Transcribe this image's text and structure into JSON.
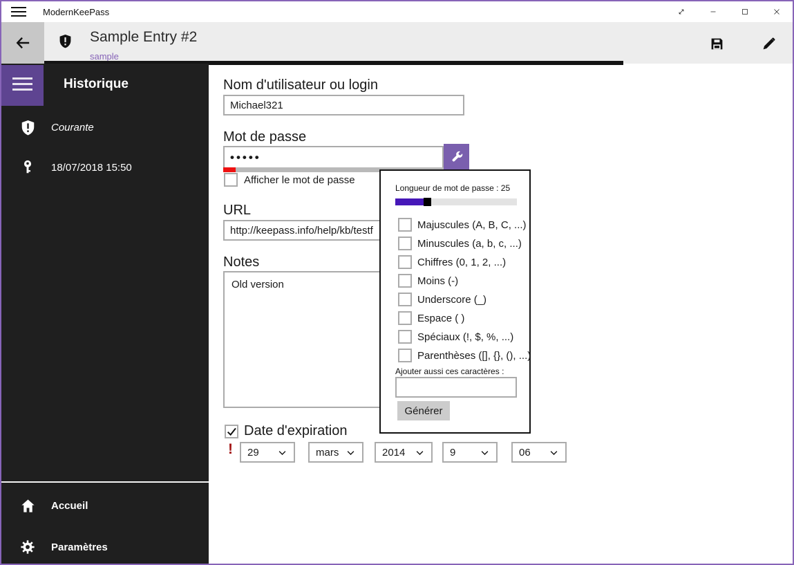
{
  "window": {
    "title": "ModernKeePass"
  },
  "header": {
    "entry_title": "Sample Entry #2",
    "entry_group": "sample"
  },
  "sidebar": {
    "heading": "Historique",
    "history_items": [
      {
        "icon": "shield-icon",
        "label": "Courante"
      },
      {
        "icon": "key-icon",
        "label": "18/07/2018 15:50"
      }
    ],
    "footer_items": [
      {
        "icon": "home-icon",
        "label": "Accueil"
      },
      {
        "icon": "gear-icon",
        "label": "Paramètres"
      }
    ]
  },
  "form": {
    "username": {
      "label": "Nom d'utilisateur ou login",
      "value": "Michael321"
    },
    "password": {
      "label": "Mot de passe",
      "value": "•••••"
    },
    "show_password_label": "Afficher le mot de passe",
    "url": {
      "label": "URL",
      "value": "http://keepass.info/help/kb/testf"
    },
    "notes": {
      "label": "Notes",
      "value": "Old version"
    },
    "expiration": {
      "label": "Date d'expiration",
      "checked": true,
      "warning": "!",
      "date_parts": [
        "29",
        "mars",
        "2014",
        "9",
        "06"
      ]
    }
  },
  "generator_popup": {
    "length_label": "Longueur de mot de passe : 25",
    "options": [
      {
        "label": "Majuscules (A, B, C, ...)",
        "checked": true
      },
      {
        "label": "Minuscules (a, b, c, ...)",
        "checked": true
      },
      {
        "label": "Chiffres (0, 1, 2, ...)",
        "checked": true
      },
      {
        "label": "Moins (-)",
        "checked": false
      },
      {
        "label": "Underscore (_)",
        "checked": false
      },
      {
        "label": "Espace ( )",
        "checked": false
      },
      {
        "label": "Spéciaux (!, $, %, ...)",
        "checked": false
      },
      {
        "label": "Parenthèses ([], {}, (), ...)",
        "checked": false
      }
    ],
    "custom_chars_label": "Ajouter aussi ces caractères :",
    "custom_chars_value": "",
    "generate_label": "Générer"
  },
  "colors": {
    "accent": "#7a5fae",
    "accent_dark": "#5e4491",
    "link": "#8764b8",
    "window_border": "#8764b8",
    "slider_fill": "#4617b8",
    "slider_track": "#e3e3e3",
    "strength_red": "#ee1111"
  }
}
